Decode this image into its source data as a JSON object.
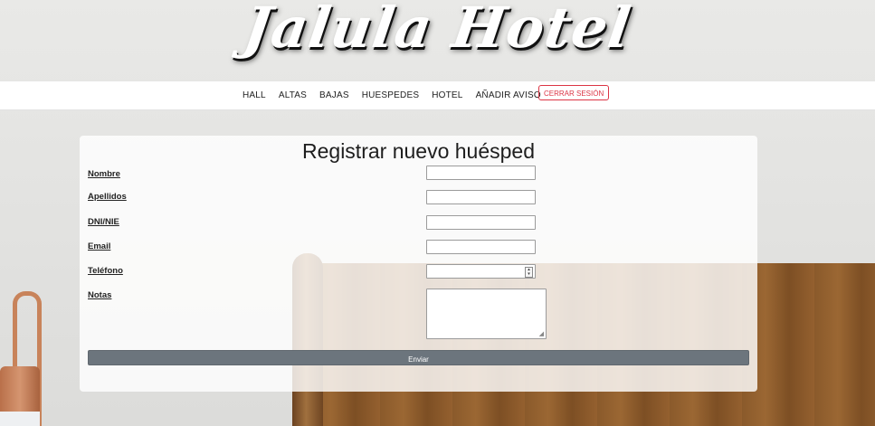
{
  "brand": {
    "logo_text": "Jalula Hotel"
  },
  "nav": {
    "links": [
      "HALL",
      "ALTAS",
      "BAJAS",
      "HUESPEDES",
      "HOTEL",
      "AÑADIR AVISO"
    ],
    "logout_label": "CERRAR SESIÓN",
    "logout_color": "#dc3545"
  },
  "form": {
    "title": "Registrar nuevo huésped",
    "fields": {
      "nombre": {
        "label": "Nombre",
        "value": ""
      },
      "apellidos": {
        "label": "Apellidos",
        "value": ""
      },
      "dni": {
        "label": "DNI/NIE",
        "value": ""
      },
      "email": {
        "label": "Email",
        "value": ""
      },
      "telefono": {
        "label": "Teléfono",
        "value": ""
      },
      "notas": {
        "label": "Notas",
        "value": ""
      }
    },
    "submit_label": "Enviar",
    "submit_color": "#6c757d"
  }
}
